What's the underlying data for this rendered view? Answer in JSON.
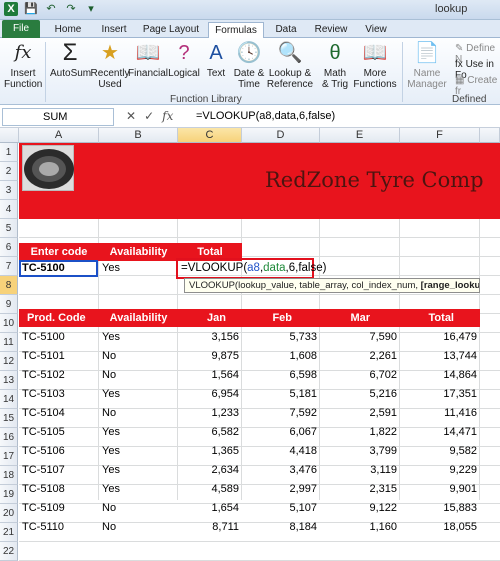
{
  "window": {
    "title": "lookup"
  },
  "tabs": [
    "File",
    "Home",
    "Insert",
    "Page Layout",
    "Formulas",
    "Data",
    "Review",
    "View"
  ],
  "ribbon": {
    "buttons": [
      {
        "label": "Insert\nFunction"
      },
      {
        "label": "AutoSum"
      },
      {
        "label": "Recently\nUsed"
      },
      {
        "label": "Financial"
      },
      {
        "label": "Logical"
      },
      {
        "label": "Text"
      },
      {
        "label": "Date &\nTime"
      },
      {
        "label": "Lookup &\nReference"
      },
      {
        "label": "Math\n& Trig"
      },
      {
        "label": "More\nFunctions"
      },
      {
        "label": "Name\nManager"
      }
    ],
    "group_label": "Function Library",
    "defined_names": [
      "Define N",
      "Use in Fo",
      "Create fr"
    ],
    "defined_names_label": "Defined Nam"
  },
  "formula_bar": {
    "name_box": "SUM",
    "formula": "=VLOOKUP(a8,data,6,false)"
  },
  "columns": [
    "A",
    "B",
    "C",
    "D",
    "E",
    "F"
  ],
  "rows": [
    "1",
    "2",
    "3",
    "4",
    "5",
    "6",
    "7",
    "8",
    "9",
    "10",
    "11",
    "12",
    "13",
    "14",
    "15",
    "16",
    "17",
    "18",
    "19",
    "20",
    "21",
    "22"
  ],
  "banner": {
    "title": "RedZone Tyre Comp"
  },
  "lookup": {
    "headers": [
      "Enter code",
      "Availability",
      "Total"
    ],
    "code": "TC-5100",
    "availability": "Yes",
    "formula_prefix": "=VLOOKUP(",
    "formula_arg1": "a8",
    "formula_sep1": ",",
    "formula_arg2": "data",
    "formula_rest": ",6,false)",
    "tooltip": "VLOOKUP(lookup_value, table_array, col_index_num, ",
    "tooltip_bold": "[range_lookup]",
    "tooltip_end": ")"
  },
  "table": {
    "headers": [
      "Prod. Code",
      "Availability",
      "Jan",
      "Feb",
      "Mar",
      "Total"
    ],
    "rows": [
      [
        "TC-5100",
        "Yes",
        "3,156",
        "5,733",
        "7,590",
        "16,479"
      ],
      [
        "TC-5101",
        "No",
        "9,875",
        "1,608",
        "2,261",
        "13,744"
      ],
      [
        "TC-5102",
        "No",
        "1,564",
        "6,598",
        "6,702",
        "14,864"
      ],
      [
        "TC-5103",
        "Yes",
        "6,954",
        "5,181",
        "5,216",
        "17,351"
      ],
      [
        "TC-5104",
        "No",
        "1,233",
        "7,592",
        "2,591",
        "11,416"
      ],
      [
        "TC-5105",
        "Yes",
        "6,582",
        "6,067",
        "1,822",
        "14,471"
      ],
      [
        "TC-5106",
        "Yes",
        "1,365",
        "4,418",
        "3,799",
        "9,582"
      ],
      [
        "TC-5107",
        "Yes",
        "2,634",
        "3,476",
        "3,119",
        "9,229"
      ],
      [
        "TC-5108",
        "Yes",
        "4,589",
        "2,997",
        "2,315",
        "9,901"
      ],
      [
        "TC-5109",
        "No",
        "1,654",
        "5,107",
        "9,122",
        "15,883"
      ],
      [
        "TC-5110",
        "No",
        "8,711",
        "8,184",
        "1,160",
        "18,055"
      ]
    ]
  }
}
